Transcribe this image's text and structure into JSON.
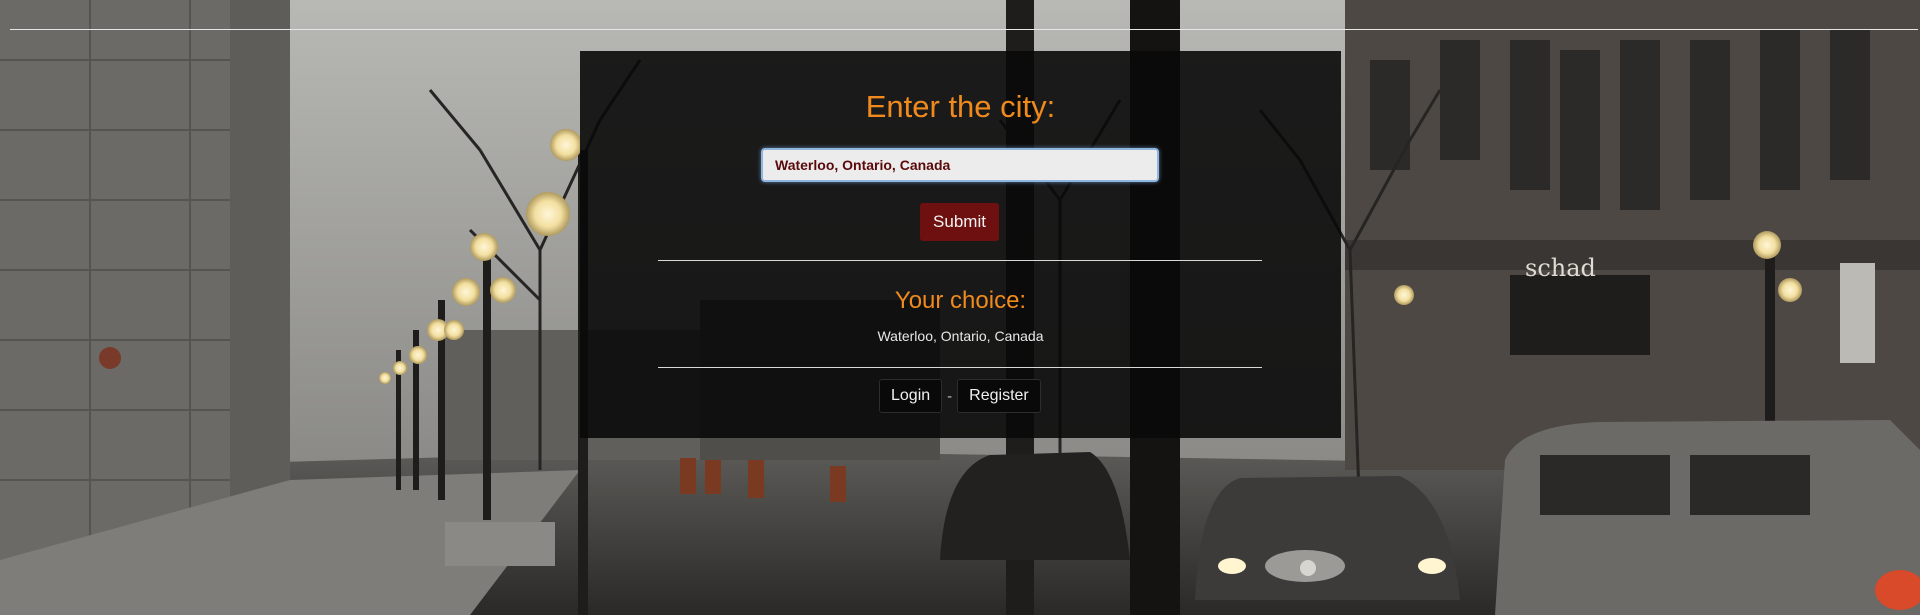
{
  "background": {
    "description_icon": "city-street-photo",
    "storefront_sign": "schad"
  },
  "form": {
    "heading": "Enter the city:",
    "city_value": "Waterloo, Ontario, Canada",
    "submit_label": "Submit"
  },
  "choice": {
    "heading": "Your choice:",
    "value": "Waterloo, Ontario, Canada"
  },
  "auth": {
    "login_label": "Login",
    "separator": "-",
    "register_label": "Register"
  },
  "colors": {
    "accent": "#f08a1c",
    "submit_bg": "#6e1010",
    "panel_bg": "#0a0a0a"
  }
}
